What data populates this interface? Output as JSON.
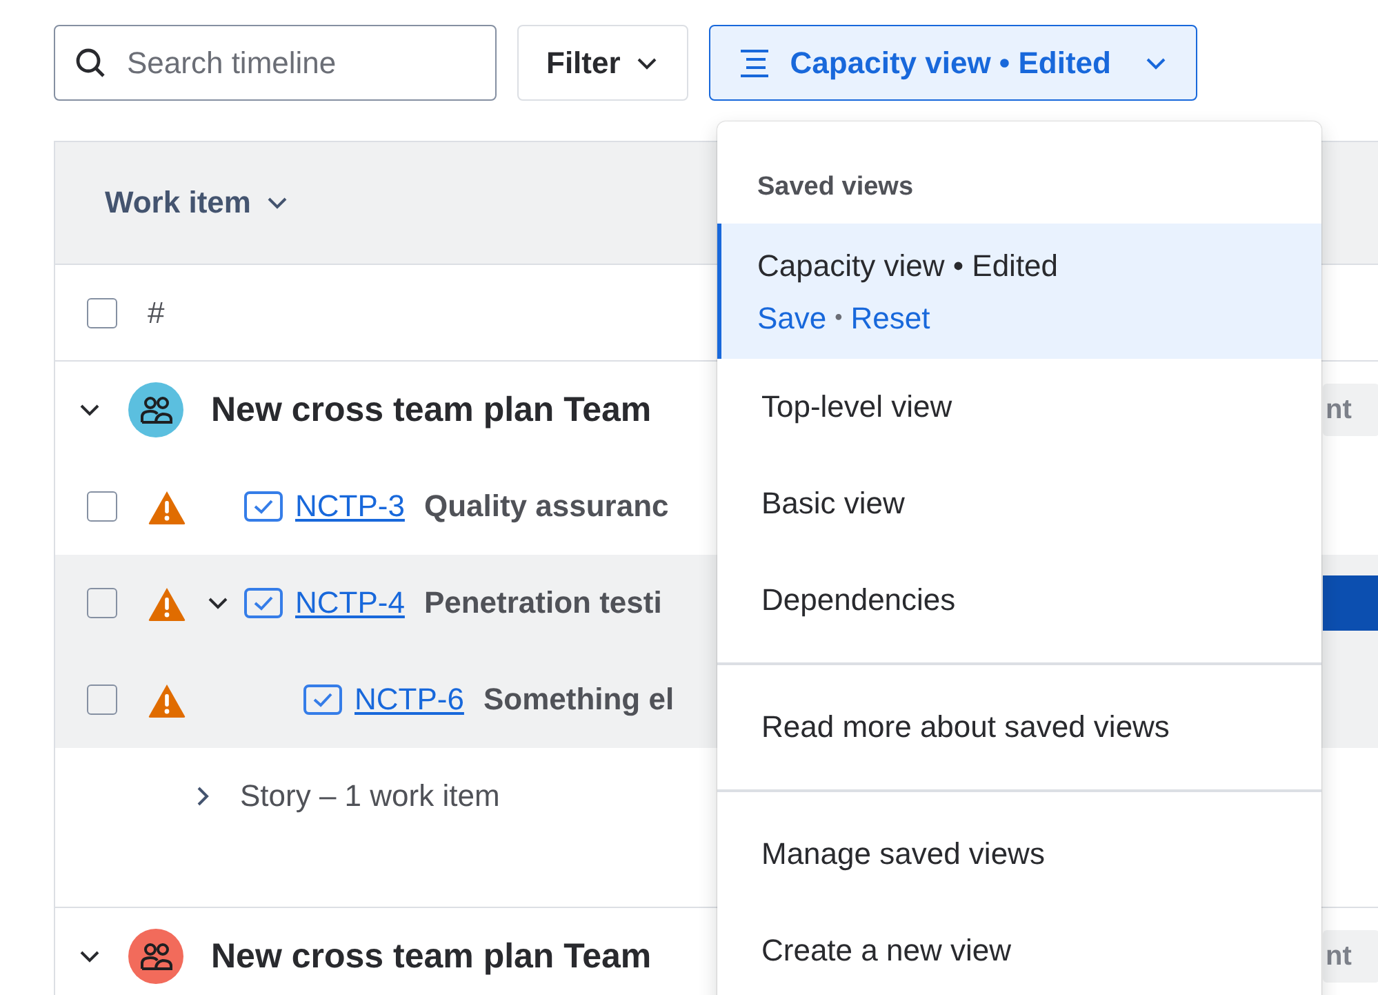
{
  "toolbar": {
    "search": {
      "placeholder": "Search timeline"
    },
    "filter": {
      "label": "Filter"
    },
    "view_button": {
      "label": "Capacity view • Edited"
    }
  },
  "table": {
    "header": {
      "column_1": "Work item"
    },
    "select_all": {
      "checked": false,
      "label": "#"
    },
    "groups": [
      {
        "title": "New cross team plan Team",
        "color": "#5bbfdf",
        "expanded": true,
        "column_2": "nt",
        "rows": [
          {
            "key": "NCTP-3",
            "summary": "Quality assuranc",
            "checked": false,
            "warning": true,
            "highlighted": false,
            "bar": false
          },
          {
            "key": "NCTP-4",
            "summary": "Penetration testi",
            "checked": false,
            "warning": true,
            "highlighted": true,
            "bar": true,
            "expanded": true,
            "children": [
              {
                "key": "NCTP-6",
                "summary": "Something el",
                "checked": false,
                "warning": true,
                "highlighted": true,
                "bar": false
              }
            ]
          }
        ],
        "footer": {
          "label": "Story – 1 work item",
          "expanded": false
        }
      },
      {
        "title": "New cross team plan Team",
        "color": "#f26b5b",
        "expanded": true,
        "column_2": "nt"
      }
    ]
  },
  "menu": {
    "heading": "Saved views",
    "views": [
      {
        "label": "Capacity view • Edited",
        "selected": true,
        "actions": [
          "Save",
          "Reset"
        ],
        "separator": "•"
      },
      {
        "label": "Top-level view",
        "selected": false
      },
      {
        "label": "Basic view",
        "selected": false
      },
      {
        "label": "Dependencies",
        "selected": false
      }
    ],
    "links": [
      "Read more about saved views"
    ],
    "actions": [
      "Manage saved views",
      "Create a new view"
    ]
  }
}
